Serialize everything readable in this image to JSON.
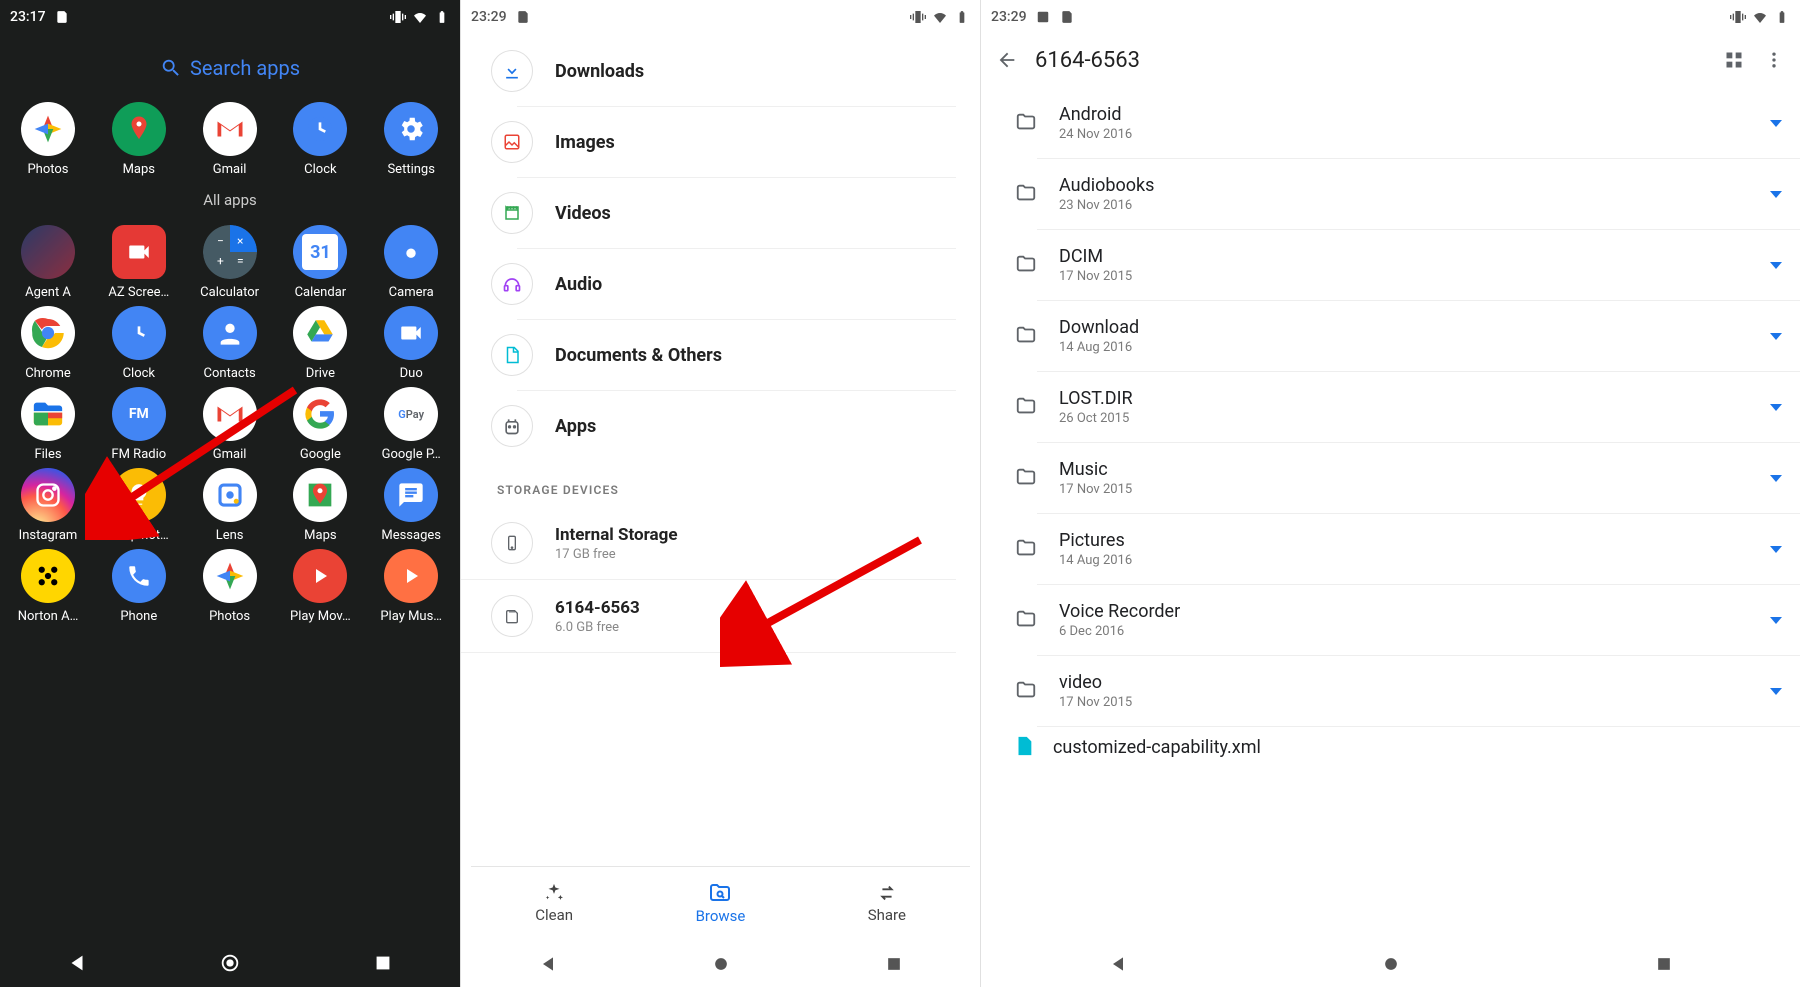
{
  "phone1": {
    "status_time": "23:17",
    "search_placeholder": "Search apps",
    "all_apps_label": "All apps",
    "row1": [
      {
        "label": "Photos"
      },
      {
        "label": "Maps"
      },
      {
        "label": "Gmail"
      },
      {
        "label": "Clock"
      },
      {
        "label": "Settings"
      }
    ],
    "row2": [
      {
        "label": "Agent A"
      },
      {
        "label": "AZ Scree…"
      },
      {
        "label": "Calculator"
      },
      {
        "label": "Calendar"
      },
      {
        "label": "Camera"
      }
    ],
    "row3": [
      {
        "label": "Chrome"
      },
      {
        "label": "Clock"
      },
      {
        "label": "Contacts"
      },
      {
        "label": "Drive"
      },
      {
        "label": "Duo"
      }
    ],
    "row4": [
      {
        "label": "Files"
      },
      {
        "label": "FM Radio"
      },
      {
        "label": "Gmail"
      },
      {
        "label": "Google"
      },
      {
        "label": "Google P…"
      }
    ],
    "row5": [
      {
        "label": "Instagram"
      },
      {
        "label": "Keep not…"
      },
      {
        "label": "Lens"
      },
      {
        "label": "Maps"
      },
      {
        "label": "Messages"
      }
    ],
    "row6": [
      {
        "label": "Norton A…"
      },
      {
        "label": "Phone"
      },
      {
        "label": "Photos"
      },
      {
        "label": "Play Mov…"
      },
      {
        "label": "Play Mus…"
      }
    ]
  },
  "phone2": {
    "status_time": "23:29",
    "categories": [
      {
        "label": "Downloads"
      },
      {
        "label": "Images"
      },
      {
        "label": "Videos"
      },
      {
        "label": "Audio"
      },
      {
        "label": "Documents & Others"
      },
      {
        "label": "Apps"
      }
    ],
    "section_title": "STORAGE DEVICES",
    "storage": [
      {
        "title": "Internal Storage",
        "sub": "17 GB free"
      },
      {
        "title": "6164-6563",
        "sub": "6.0 GB free"
      }
    ],
    "tabs": {
      "clean": "Clean",
      "browse": "Browse",
      "share": "Share"
    }
  },
  "phone3": {
    "status_time": "23:29",
    "title": "6164-6563",
    "folders": [
      {
        "name": "Android",
        "date": "24 Nov 2016"
      },
      {
        "name": "Audiobooks",
        "date": "23 Nov 2016"
      },
      {
        "name": "DCIM",
        "date": "17 Nov 2015"
      },
      {
        "name": "Download",
        "date": "14 Aug 2016"
      },
      {
        "name": "LOST.DIR",
        "date": "26 Oct 2015"
      },
      {
        "name": "Music",
        "date": "17 Nov 2015"
      },
      {
        "name": "Pictures",
        "date": "14 Aug 2016"
      },
      {
        "name": "Voice Recorder",
        "date": "6 Dec 2016"
      },
      {
        "name": "video",
        "date": "17 Nov 2015"
      }
    ],
    "xml_file": "customized-capability.xml"
  }
}
